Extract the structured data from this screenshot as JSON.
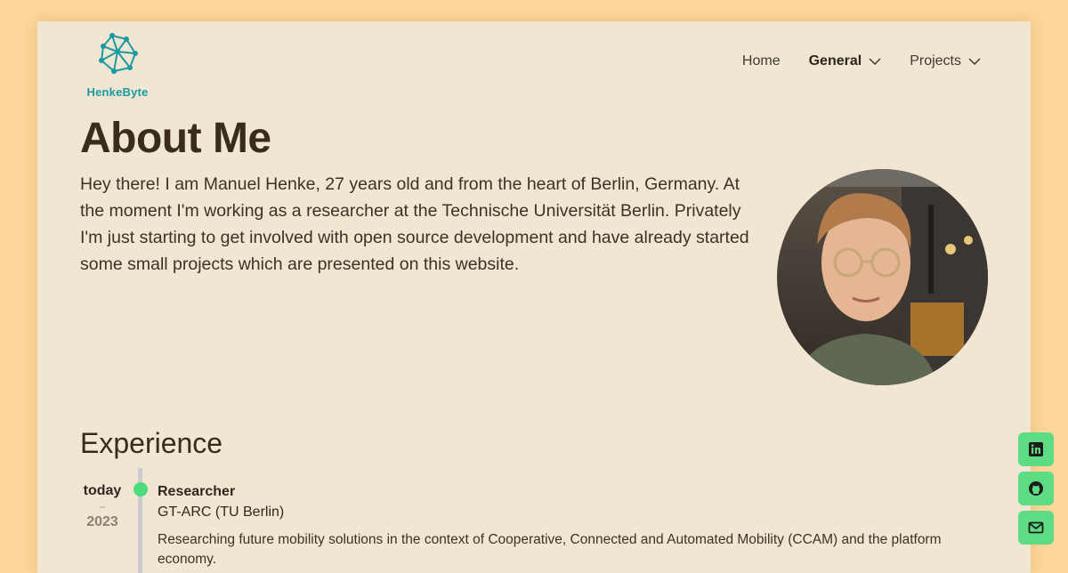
{
  "brand": {
    "name": "HenkeByte",
    "color": "#1a9aa1"
  },
  "nav": {
    "home": "Home",
    "general": "General",
    "projects": "Projects"
  },
  "about": {
    "title": "About Me",
    "intro": "Hey there! I am Manuel Henke, 27 years old and from the heart of Berlin, Germany. At the moment I'm working as a researcher at the Technische Universität Berlin. Privately I'm just starting to get involved with open source development and have already started some small projects which are presented on this website."
  },
  "experience": {
    "title": "Experience",
    "items": [
      {
        "end": "today",
        "dash": "–",
        "start": "2023",
        "role": "Researcher",
        "org": "GT-ARC (TU Berlin)",
        "description": "Researching future mobility solutions in the context of Cooperative, Connected and Automated Mobility (CCAM) and the platform economy."
      }
    ]
  },
  "social": {
    "icons": [
      "linkedin-icon",
      "github-icon",
      "mail-icon"
    ],
    "color": "#5ddc84"
  },
  "colors": {
    "page_bg": "#fed69a",
    "card_bg": "#f1e6d1",
    "accent": "#4ddc7c"
  }
}
